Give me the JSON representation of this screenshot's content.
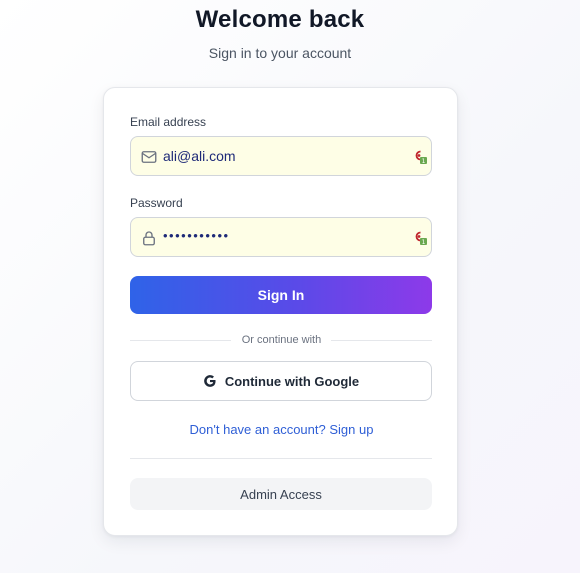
{
  "header": {
    "title": "Welcome back",
    "subtitle": "Sign in to your account"
  },
  "form": {
    "email": {
      "label": "Email address",
      "value": "ali@ali.com",
      "lead_icon": "mail-icon",
      "extension_icon": "password-manager-icon",
      "extension_badge": "1"
    },
    "password": {
      "label": "Password",
      "value_masked": "•••••••••••",
      "lead_icon": "lock-icon",
      "extension_icon": "password-manager-icon",
      "extension_badge": "1"
    },
    "submit_label": "Sign In"
  },
  "divider_text": "Or continue with",
  "google_button": {
    "label": "Continue with Google",
    "icon": "google-icon"
  },
  "signup_link": "Don't have an account? Sign up",
  "admin_button": "Admin Access",
  "colors": {
    "primary_start": "#2f63e8",
    "primary_end": "#8d3ae9",
    "link": "#2f5fd6",
    "autofill_bg": "#fefee6"
  }
}
